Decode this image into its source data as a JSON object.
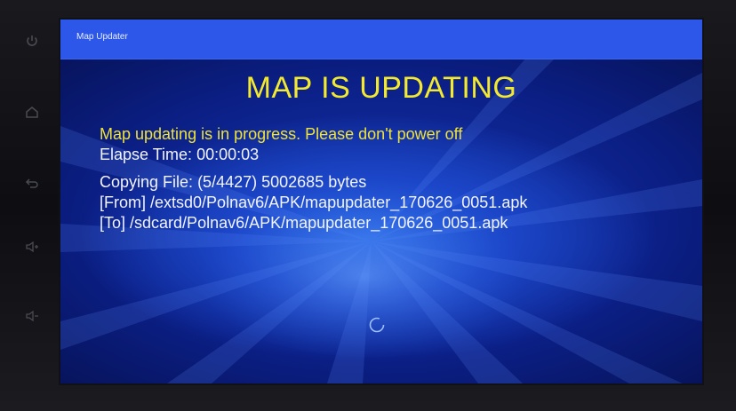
{
  "window": {
    "title": "Map Updater"
  },
  "heading": "MAP IS UPDATING",
  "status": {
    "warning": "Map updating is in progress. Please don't power off",
    "elapse_label": "Elapse Time:",
    "elapse_value": "00:00:03",
    "copying_label": "Copying File:",
    "copying_progress": "(5/4427)",
    "copying_bytes": "5002685 bytes",
    "from_label": "[From]",
    "from_path": "/extsd0/Polnav6/APK/mapupdater_170626_0051.apk",
    "to_label": "[To]",
    "to_path": "/sdcard/Polnav6/APK/mapupdater_170626_0051.apk"
  },
  "device_buttons": [
    "power-icon",
    "home-icon",
    "back-icon",
    "volume-up-icon",
    "volume-down-icon"
  ],
  "colors": {
    "title_bar": "#2c57e8",
    "heading": "#f3ea2f",
    "warning_text": "#efe33a",
    "body_text": "#f2f4ff",
    "screen_background": "#1537b0"
  }
}
